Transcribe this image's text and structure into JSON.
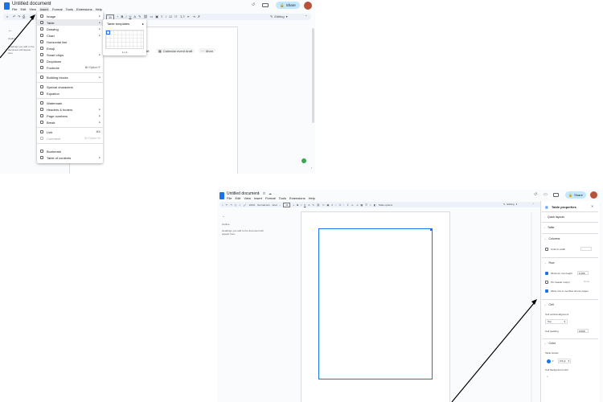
{
  "top": {
    "doc_title": "Untitled document",
    "menus": [
      "File",
      "Edit",
      "View",
      "Insert",
      "Format",
      "Tools",
      "Extensions",
      "Help"
    ],
    "share_label": "Share",
    "editing_label": "Editing",
    "outline_label": "Headings you add to the document will appear here.",
    "insert_menu": [
      {
        "label": "Image",
        "arrow": true
      },
      {
        "label": "Table",
        "arrow": true
      },
      {
        "label": "Drawing",
        "arrow": true
      },
      {
        "label": "Chart",
        "arrow": true
      },
      {
        "label": "Horizontal line"
      },
      {
        "label": "Emoji"
      },
      {
        "label": "Smart chips",
        "arrow": true
      },
      {
        "label": "Dropdown"
      },
      {
        "label": "Footnote",
        "shortcut": "⌘+Option+F"
      },
      {
        "label": "Building blocks",
        "arrow": true
      },
      {
        "label": "Special characters"
      },
      {
        "label": "Equation"
      },
      {
        "label": "Watermark"
      },
      {
        "label": "Headers & footers",
        "arrow": true
      },
      {
        "label": "Page numbers",
        "arrow": true
      },
      {
        "label": "Break",
        "arrow": true
      },
      {
        "label": "Link",
        "shortcut": "⌘K"
      },
      {
        "label": "Comment",
        "shortcut": "⌘+Option+M",
        "disabled": true
      },
      {
        "label": "Bookmark"
      },
      {
        "label": "Table of contents",
        "arrow": true
      }
    ],
    "table_submenu": {
      "templates_label": "Table templates",
      "grid_size": "1 x 1"
    },
    "chips": [
      "Calendar event draft",
      "More"
    ],
    "chip_partial": "aft"
  },
  "bottom": {
    "doc_title": "Untitled document",
    "menus": [
      "File",
      "Edit",
      "View",
      "Insert",
      "Format",
      "Tools",
      "Extensions",
      "Help"
    ],
    "share_label": "Share",
    "editing_label": "Editing",
    "font_label": "Arial",
    "zoom_label": "100%",
    "style_label": "Normal text",
    "table_options_label": "Table options",
    "outline_title": "Outline",
    "outline_text": "Headings you add to the document will appear here.",
    "panel": {
      "title": "Table properties",
      "sections": {
        "quick_layouts": "Quick layouts",
        "table": "Table",
        "columns": "Columns",
        "column_width": "Column width",
        "row": "Row",
        "min_row_height": "Minimum row height",
        "min_row_height_value": "0.105",
        "pin_header": "Pin header row(s)",
        "pin_header_value": "None",
        "overflow": "Allow row to overflow across pages",
        "cell": "Cell",
        "vertical_alignment": "Cell vertical alignment",
        "vertical_alignment_value": "Top",
        "cell_padding": "Cell padding",
        "cell_padding_value": "0.069",
        "color": "Color",
        "table_border": "Table border",
        "border_width": "0.5 pt",
        "cell_background": "Cell background color"
      }
    }
  }
}
